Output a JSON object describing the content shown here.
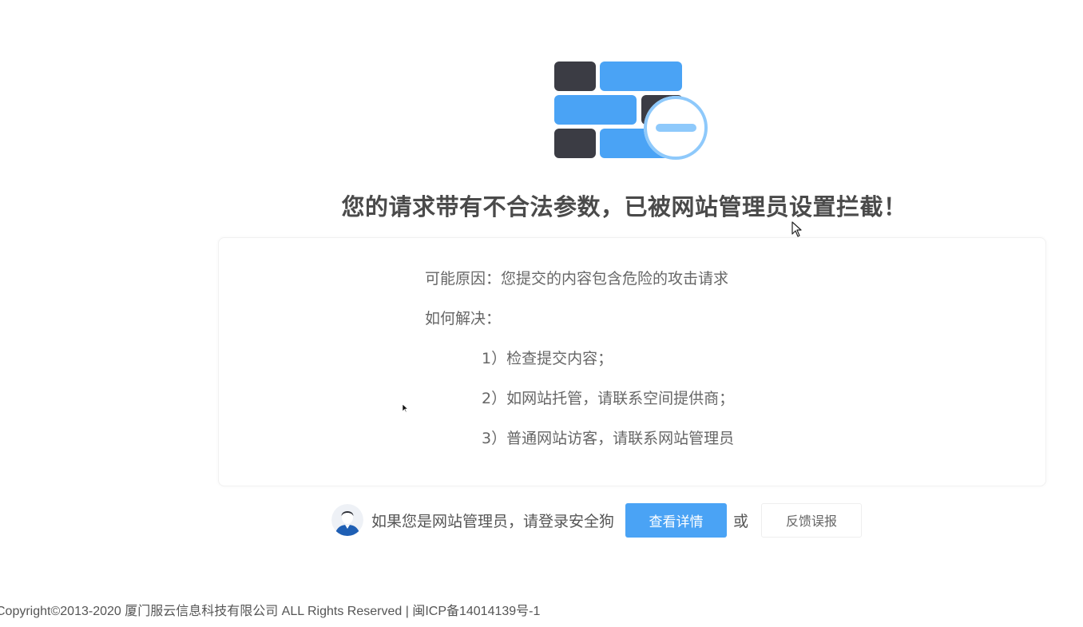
{
  "title": "您的请求带有不合法参数，已被网站管理员设置拦截！",
  "reason": {
    "label": "可能原因：",
    "text": "您提交的内容包含危险的攻击请求"
  },
  "solution": {
    "label": "如何解决：",
    "steps": [
      "1）检查提交内容；",
      "2）如网站托管，请联系空间提供商；",
      "3）普通网站访客，请联系网站管理员"
    ]
  },
  "admin": {
    "prompt": "如果您是网站管理员，请登录安全狗",
    "detail_button": "查看详情",
    "or": "或",
    "feedback_button": "反馈误报"
  },
  "footer": {
    "copyright": "Copyright©2013-2020 厦门服云信息科技有限公司 ALL Rights Reserved | 闽ICP备14014139号-1"
  },
  "colors": {
    "brick_dark": "#3b3c44",
    "brick_blue": "#4aa3f5",
    "badge_light": "#8ec9fb",
    "button_blue": "#4aa3f5"
  },
  "icons": {
    "logo": "firewall-brick-icon",
    "avatar": "admin-avatar-icon"
  }
}
